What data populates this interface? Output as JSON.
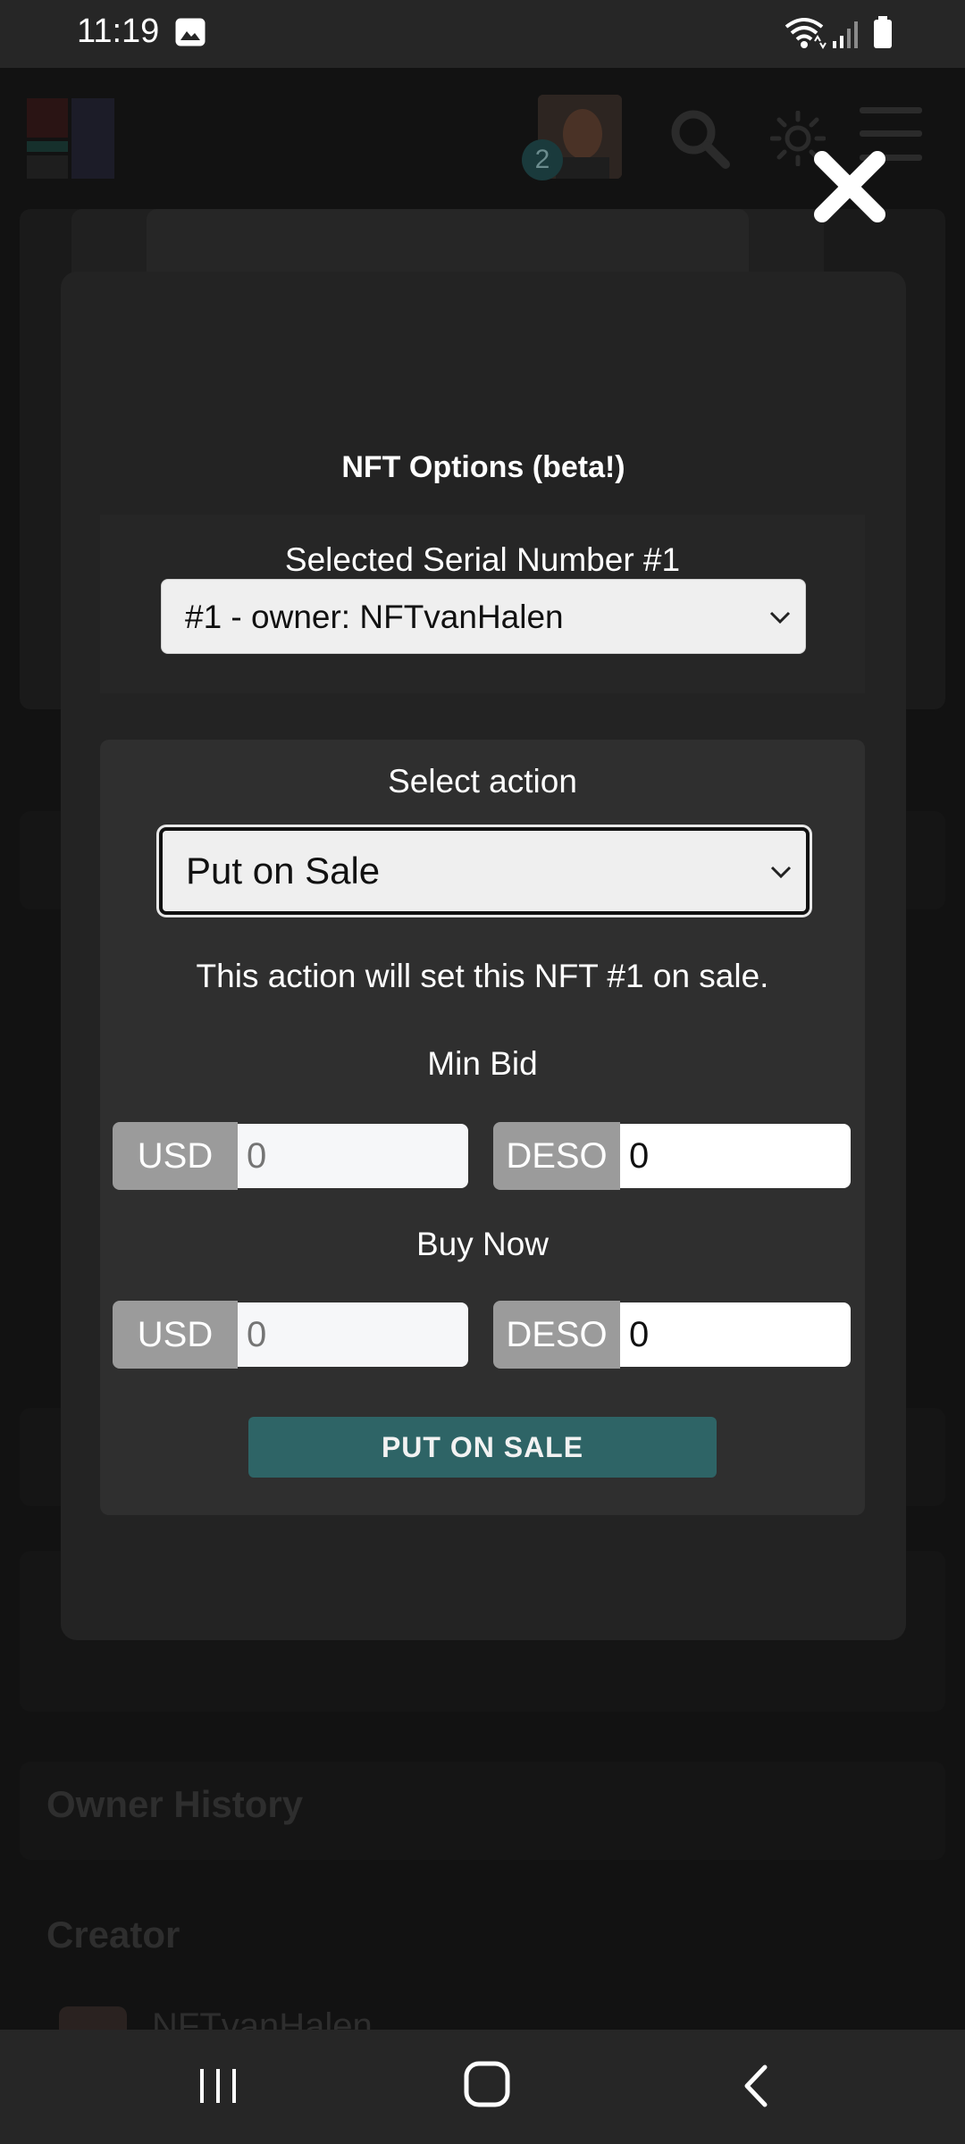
{
  "status_bar": {
    "time": "11:19"
  },
  "background_page": {
    "notification_count": "2",
    "section_owner_history": "Owner History",
    "section_creator": "Creator",
    "creator_name": "NFTvanHalen"
  },
  "modal": {
    "title": "NFT Options (beta!)",
    "serial_label": "Selected Serial Number #1",
    "serial_select_value": "#1 - owner: NFTvanHalen",
    "action_label": "Select action",
    "action_select_value": "Put on Sale",
    "action_description": "This action will set this NFT #1 on sale.",
    "min_bid": {
      "label": "Min Bid",
      "usd_prefix": "USD",
      "usd_placeholder": "0",
      "deso_prefix": "DESO",
      "deso_value": "0"
    },
    "buy_now": {
      "label": "Buy Now",
      "usd_prefix": "USD",
      "usd_placeholder": "0",
      "deso_prefix": "DESO",
      "deso_value": "0"
    },
    "submit_label": "PUT ON SALE"
  },
  "colors": {
    "modal_bg": "#232323",
    "action_box_bg": "#2f2f2f",
    "primary_button": "#2e6466",
    "prefix_bg": "#9b9b9b"
  },
  "icons": [
    "gallery-icon",
    "wifi-icon",
    "signal-icon",
    "battery-icon",
    "search-icon",
    "sun-icon",
    "hamburger-menu-icon",
    "close-icon",
    "chevron-down-icon",
    "recents-icon",
    "home-icon",
    "back-icon"
  ]
}
